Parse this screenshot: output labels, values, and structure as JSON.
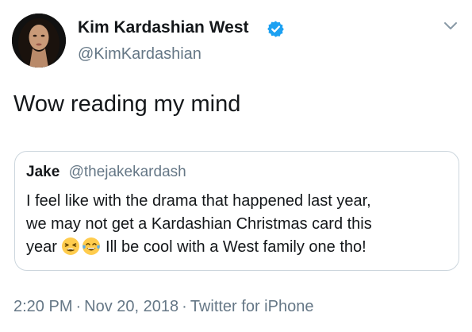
{
  "author": {
    "name": "Kim Kardashian West",
    "handle": "@KimKardashian",
    "verified": true,
    "verified_color": "#1da1f2"
  },
  "tweet": {
    "text": "Wow reading my mind"
  },
  "quoted_tweet": {
    "name": "Jake",
    "handle": "@thejakekardash",
    "line1": "I feel like with the drama that happened last year,",
    "line2": "we may not get a Kardashian Christmas card this",
    "line3_prefix": "year",
    "emojis": [
      "tired-face-emoji",
      "face-with-tears-of-joy-emoji"
    ],
    "line3_suffix": "Ill be cool with a West family one tho!"
  },
  "meta": {
    "time": "2:20 PM",
    "separator": "·",
    "date": "Nov 20, 2018",
    "source": "Twitter for iPhone"
  },
  "colors": {
    "text": "#14171a",
    "secondary_text": "#657786",
    "border": "#ccd6dd",
    "accent": "#1da1f2"
  },
  "icons": {
    "menu": "chevron-down-icon",
    "verified": "verified-badge-icon"
  }
}
